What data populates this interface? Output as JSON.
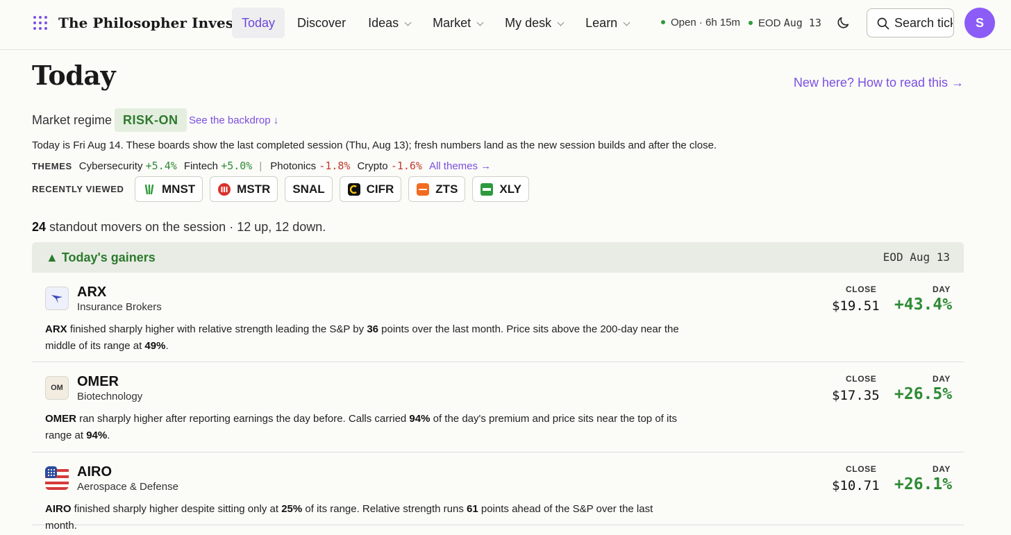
{
  "header": {
    "brand": "The Philosopher Investor",
    "nav": [
      {
        "label": "Today",
        "active": true,
        "dropdown": false
      },
      {
        "label": "Discover",
        "active": false,
        "dropdown": false
      },
      {
        "label": "Ideas",
        "active": false,
        "dropdown": true
      },
      {
        "label": "Market",
        "active": false,
        "dropdown": true
      },
      {
        "label": "My desk",
        "active": false,
        "dropdown": true
      },
      {
        "label": "Learn",
        "active": false,
        "dropdown": true
      }
    ],
    "market_status": "Open · 6h 15m",
    "eod_label": "EOD",
    "eod_date": "Aug 13",
    "search_placeholder": "Search tickers",
    "avatar_initial": "S",
    "accent_color": "#7b4fe0",
    "status_color": "#2f9a3a"
  },
  "page": {
    "title": "Today",
    "how_link": "New here? How to read this →",
    "regime_label": "Market regime",
    "regime_value": "RISK-ON",
    "backdrop_link": "See the backdrop ↓",
    "note": "Today is Fri Aug 14. These boards show the last completed session (Thu, Aug 13); fresh numbers land as the new session builds and after the close.",
    "themes_label": "THEMES",
    "themes_up": [
      {
        "name": "Cybersecurity",
        "change": "+5.4%"
      },
      {
        "name": "Fintech",
        "change": "+5.0%"
      }
    ],
    "themes_down": [
      {
        "name": "Photonics",
        "change": "-1.8%"
      },
      {
        "name": "Crypto",
        "change": "-1.6%"
      }
    ],
    "all_themes": "All themes →",
    "recent_label": "RECENTLY VIEWED",
    "recent": [
      "MNST",
      "MSTR",
      "SNAL",
      "CIFR",
      "ZTS",
      "XLY"
    ],
    "summary_count": "24",
    "summary_text": "standout movers on the session · 12 up, 12 down."
  },
  "gainers": {
    "title": "▲ Today's gainers",
    "eod": "EOD Aug 13",
    "close_label": "CLOSE",
    "day_label": "DAY",
    "items": [
      {
        "ticker": "ARX",
        "industry": "Insurance Brokers",
        "close": "$19.51",
        "day": "+43.4%",
        "desc": [
          "ARX",
          " finished sharply higher with relative strength leading the S&P by ",
          "36",
          " points over the last month. Price sits above the 200-day near the middle of its range at ",
          "49%",
          "."
        ]
      },
      {
        "ticker": "OMER",
        "industry": "Biotechnology",
        "logo_text": "OM",
        "close": "$17.35",
        "day": "+26.5%",
        "desc": [
          "OMER",
          " ran sharply higher after reporting earnings the day before. Calls carried ",
          "94%",
          " of the day's premium and price sits near the top of its range at ",
          "94%",
          "."
        ]
      },
      {
        "ticker": "AIRO",
        "industry": "Aerospace & Defense",
        "close": "$10.71",
        "day": "+26.1%",
        "desc": [
          "AIRO",
          " finished sharply higher despite sitting only at ",
          "25%",
          " of its range. Relative strength runs ",
          "61",
          " points ahead of the S&P over the last month."
        ]
      }
    ]
  }
}
